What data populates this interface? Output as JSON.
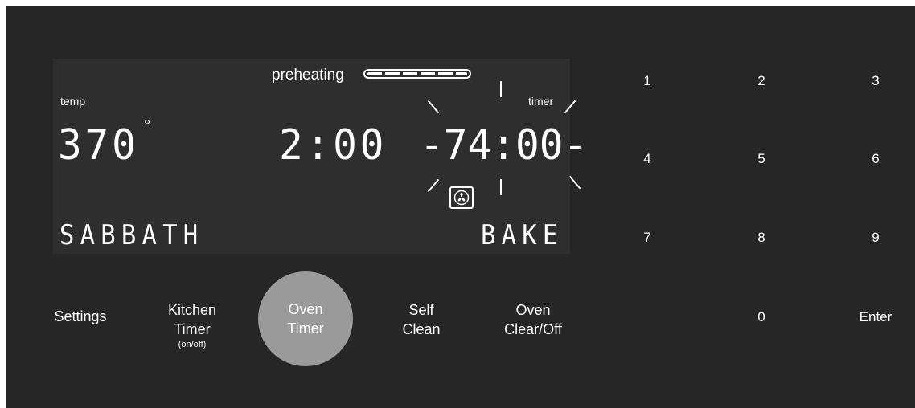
{
  "display": {
    "preheating_label": "preheating",
    "preheat_progress": 1.0,
    "temp_label": "temp",
    "temp_value": "370",
    "temp_unit": "°",
    "clock_value": "2:00",
    "timer_label": "timer",
    "timer_value": "-74:00-",
    "mode_left": "SABBATH",
    "mode_right": "BAKE"
  },
  "keypad": {
    "keys": [
      "1",
      "2",
      "3",
      "4",
      "5",
      "6",
      "7",
      "8",
      "9",
      "0",
      "Enter"
    ]
  },
  "buttons": {
    "settings": "Settings",
    "kitchen_timer_line1": "Kitchen",
    "kitchen_timer_line2": "Timer",
    "kitchen_timer_sub": "(on/off)",
    "oven_timer_line1": "Oven",
    "oven_timer_line2": "Timer",
    "self_clean_line1": "Self",
    "self_clean_line2": "Clean",
    "oven_clear_line1": "Oven",
    "oven_clear_line2": "Clear/Off"
  },
  "icons": {
    "fan": "convection-fan-icon",
    "preheat_bar": "progress-bar"
  },
  "colors": {
    "panel": "#262626",
    "display": "#2e2e2e",
    "text": "#ffffff",
    "active_button": "#9a9a9a"
  }
}
